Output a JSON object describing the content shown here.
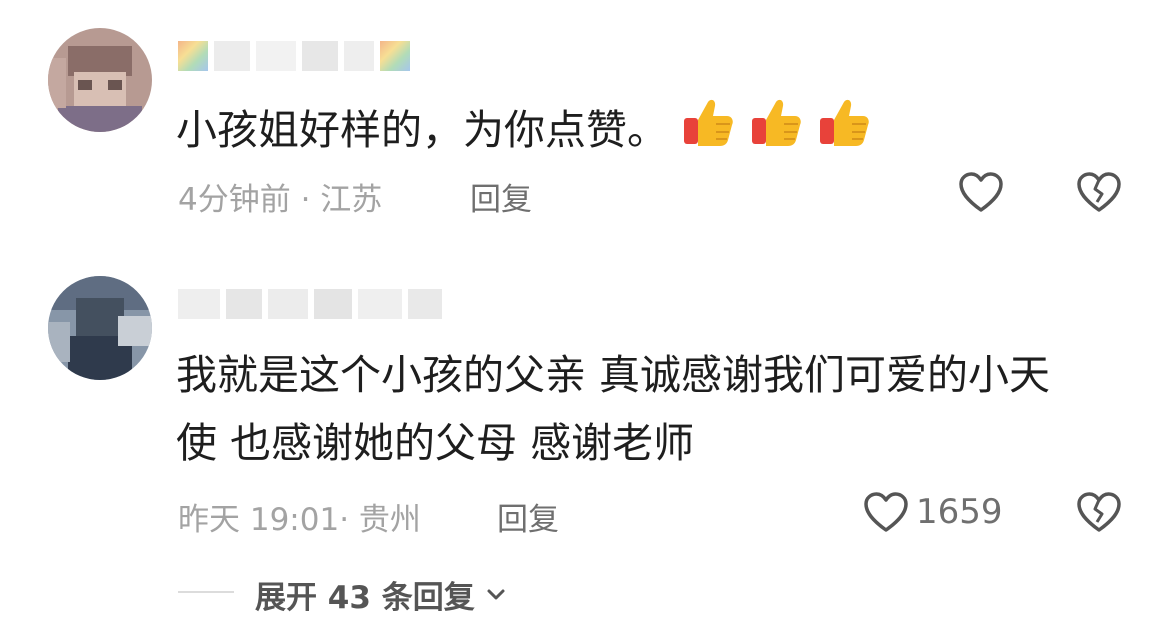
{
  "comments": [
    {
      "text": "小孩姐好样的，为你点赞。",
      "emoji": [
        "thumbs-up",
        "thumbs-up",
        "thumbs-up"
      ],
      "time": "4分钟前",
      "location": "江苏",
      "meta_separator": " · ",
      "reply_label": "回复",
      "like_count": ""
    },
    {
      "text_lines": [
        "我就是这个小孩的父亲  真诚感谢我们可爱的小天",
        "使  也感谢她的父母  感谢老师"
      ],
      "time": "昨天 19:01",
      "location": "贵州",
      "meta_separator": "· ",
      "reply_label": "回复",
      "like_count": "1659",
      "expand_label": "展开 43 条回复"
    }
  ],
  "icons": {
    "like": "heart-outline-icon",
    "dislike": "broken-heart-icon",
    "expand": "chevron-down-icon",
    "thumbs": "thumbs-up-icon"
  },
  "colors": {
    "text": "#1e1e1e",
    "meta": "#a3a3a3",
    "icon": "#555555"
  }
}
